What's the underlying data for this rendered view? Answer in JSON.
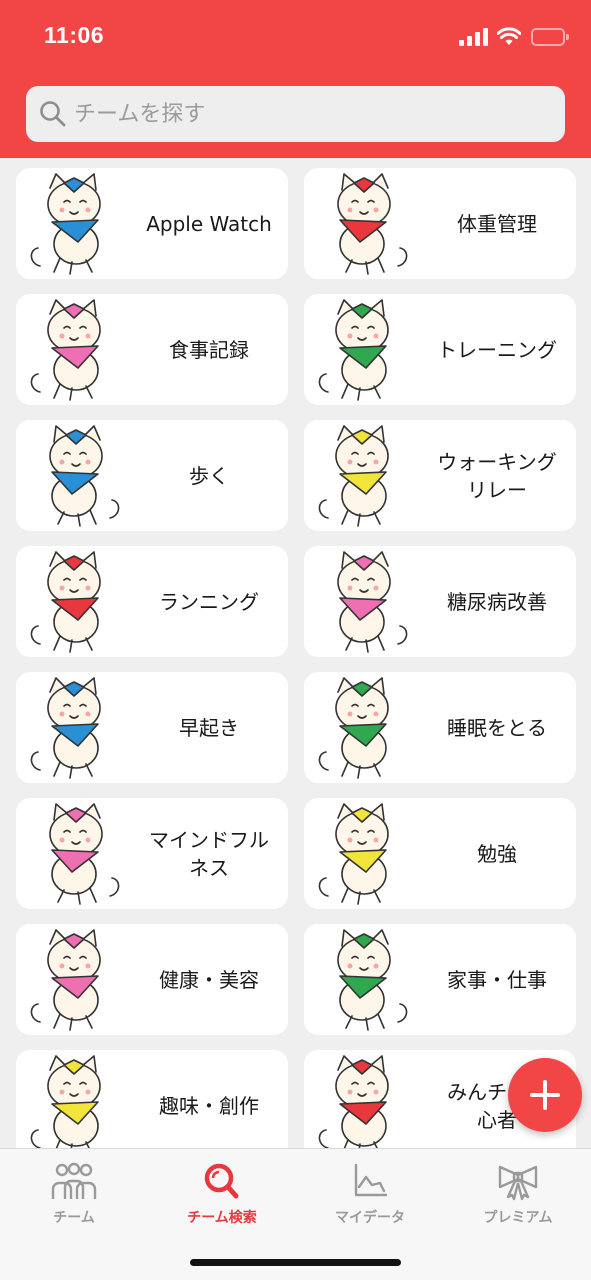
{
  "status_bar": {
    "time": "11:06"
  },
  "search": {
    "placeholder": "チームを探す",
    "icon": "magnifier-icon"
  },
  "categories": [
    {
      "label": "Apple Watch",
      "bandana": "#2b8fd6"
    },
    {
      "label": "体重管理",
      "bandana": "#e8383d"
    },
    {
      "label": "食事記録",
      "bandana": "#ee6fb2"
    },
    {
      "label": "トレーニング",
      "bandana": "#2fa84f"
    },
    {
      "label": "歩く",
      "bandana": "#2b8fd6"
    },
    {
      "label": "ウォーキング\nリレー",
      "bandana": "#f1e43a"
    },
    {
      "label": "ランニング",
      "bandana": "#e8383d"
    },
    {
      "label": "糖尿病改善",
      "bandana": "#ee6fb2"
    },
    {
      "label": "早起き",
      "bandana": "#2b8fd6"
    },
    {
      "label": "睡眠をとる",
      "bandana": "#2fa84f"
    },
    {
      "label": "マインドフル\nネス",
      "bandana": "#ee6fb2"
    },
    {
      "label": "勉強",
      "bandana": "#f1e43a"
    },
    {
      "label": "健康・美容",
      "bandana": "#ee6fb2"
    },
    {
      "label": "家事・仕事",
      "bandana": "#2fa84f"
    },
    {
      "label": "趣味・創作",
      "bandana": "#f1e43a"
    },
    {
      "label": "みんチャ初\n心者",
      "bandana": "#e8383d"
    }
  ],
  "fab": {
    "icon": "plus-icon"
  },
  "tabs": [
    {
      "label": "チーム",
      "icon": "team-icon",
      "active": false
    },
    {
      "label": "チーム検索",
      "icon": "team-search-icon",
      "active": true
    },
    {
      "label": "マイデータ",
      "icon": "chart-icon",
      "active": false
    },
    {
      "label": "プレミアム",
      "icon": "ribbon-icon",
      "active": false
    }
  ],
  "colors": {
    "brand": "#f24646",
    "active_tab": "#e8383d",
    "inactive_tab": "#9a9a9a",
    "background": "#efefef"
  }
}
